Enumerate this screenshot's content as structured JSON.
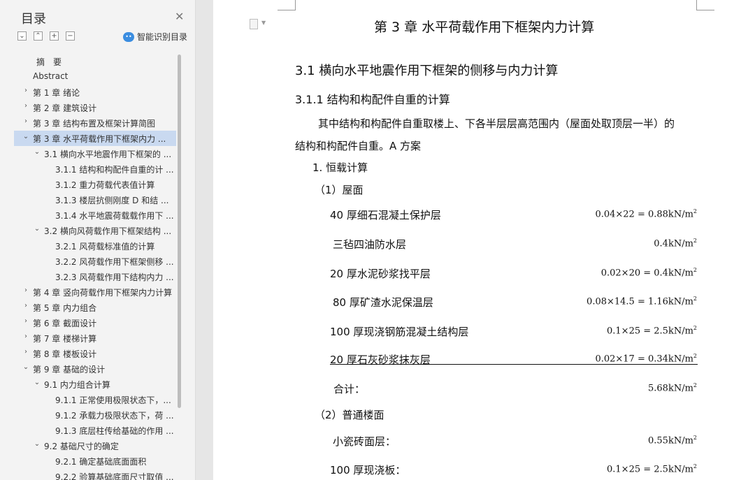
{
  "sidebar": {
    "title": "目录",
    "smart_label": "智能识别目录",
    "toc": [
      {
        "label": "摘　要",
        "level": 0,
        "arrow": ""
      },
      {
        "label": "Abstract",
        "level": 0,
        "arrow": ""
      },
      {
        "label": "第 1 章  绪论",
        "level": 0,
        "arrow": "›"
      },
      {
        "label": "第 2 章  建筑设计",
        "level": 0,
        "arrow": "›"
      },
      {
        "label": "第 3 章  结构布置及框架计算简图",
        "level": 0,
        "arrow": "›"
      },
      {
        "label": "第 3 章  水平荷载作用下框架内力 ...",
        "level": 0,
        "arrow": "⌄",
        "selected": true
      },
      {
        "label": "3.1  横向水平地震作用下框架的 ...",
        "level": 1,
        "arrow": "⌄"
      },
      {
        "label": "3.1.1  结构和构配件自重的计 ...",
        "level": 2,
        "arrow": ""
      },
      {
        "label": "3.1.2  重力荷载代表值计算",
        "level": 2,
        "arrow": ""
      },
      {
        "label": "3.1.3  楼层抗侧刚度 D 和结 ...",
        "level": 2,
        "arrow": ""
      },
      {
        "label": "3.1.4  水平地震荷载载作用下 ...",
        "level": 2,
        "arrow": ""
      },
      {
        "label": "3.2  横向风荷载作用下框架结构 ...",
        "level": 1,
        "arrow": "⌄"
      },
      {
        "label": "3.2.1 风荷载标准值的计算",
        "level": 2,
        "arrow": ""
      },
      {
        "label": "3.2.2 风荷载作用下框架侧移 ...",
        "level": 2,
        "arrow": ""
      },
      {
        "label": "3.2.3 风荷载作用下结构内力 ...",
        "level": 2,
        "arrow": ""
      },
      {
        "label": "第 4 章  竖向荷载作用下框架内力计算",
        "level": 0,
        "arrow": "›"
      },
      {
        "label": "第 5 章  内力组合",
        "level": 0,
        "arrow": "›"
      },
      {
        "label": "第 6 章  截面设计",
        "level": 0,
        "arrow": "›"
      },
      {
        "label": "第 7 章  楼梯计算",
        "level": 0,
        "arrow": "›"
      },
      {
        "label": "第 8 章  楼板设计",
        "level": 0,
        "arrow": "›"
      },
      {
        "label": "第 9 章  基础的设计",
        "level": 0,
        "arrow": "⌄"
      },
      {
        "label": "9.1  内力组合计算",
        "level": 1,
        "arrow": "⌄"
      },
      {
        "label": "9.1.1 正常使用极限状态下，...",
        "level": 2,
        "arrow": ""
      },
      {
        "label": "9.1.2 承载力极限状态下，荷 ...",
        "level": 2,
        "arrow": ""
      },
      {
        "label": "9.1.3 底层柱传给基础的作用 ...",
        "level": 2,
        "arrow": ""
      },
      {
        "label": "9.2  基础尺寸的确定",
        "level": 1,
        "arrow": "⌄"
      },
      {
        "label": "9.2.1 确定基础底面面积",
        "level": 2,
        "arrow": ""
      },
      {
        "label": "9.2.2 验算基础底面尺寸取值 ...",
        "level": 2,
        "arrow": ""
      }
    ]
  },
  "doc": {
    "chapter": "第 3 章  水平荷载作用下框架内力计算",
    "h2": "3.1  横向水平地震作用下框架的侧移与内力计算",
    "h3": "3.1.1  结构和构配件自重的计算",
    "para1": "其中结构和构配件自重取楼上、下各半层层高范围内（屋面处取顶层一半）的",
    "para2": "结构和构配件自重。A 方案",
    "item1": "1. 恒载计算",
    "sub1": "（1）屋面",
    "roof": [
      {
        "label": "40 厚细石混凝土保护层",
        "value": "0.04×22 = 0.88kN/m"
      },
      {
        "label": "三毡四油防水层",
        "value": "0.4kN/m"
      },
      {
        "label": "20 厚水泥砂浆找平层",
        "value": "0.02×20 = 0.4kN/m"
      },
      {
        "label": "80 厚矿渣水泥保温层",
        "value": "0.08×14.5 = 1.16kN/m"
      },
      {
        "label": "100 厚现浇钢筋混凝土结构层",
        "value": "0.1×25 = 2.5kN/m"
      },
      {
        "label": "20 厚石灰砂浆抹灰层",
        "value": "0.02×17 = 0.34kN/m"
      }
    ],
    "total_label": "合计：",
    "total_value": "5.68kN/m",
    "sub2": "（2）普通楼面",
    "floor": [
      {
        "label": "小瓷砖面层：",
        "value": "0.55kN/m"
      },
      {
        "label": "100 厚现浇板：",
        "value": "0.1×25 = 2.5kN/m"
      }
    ],
    "sup": "2"
  }
}
